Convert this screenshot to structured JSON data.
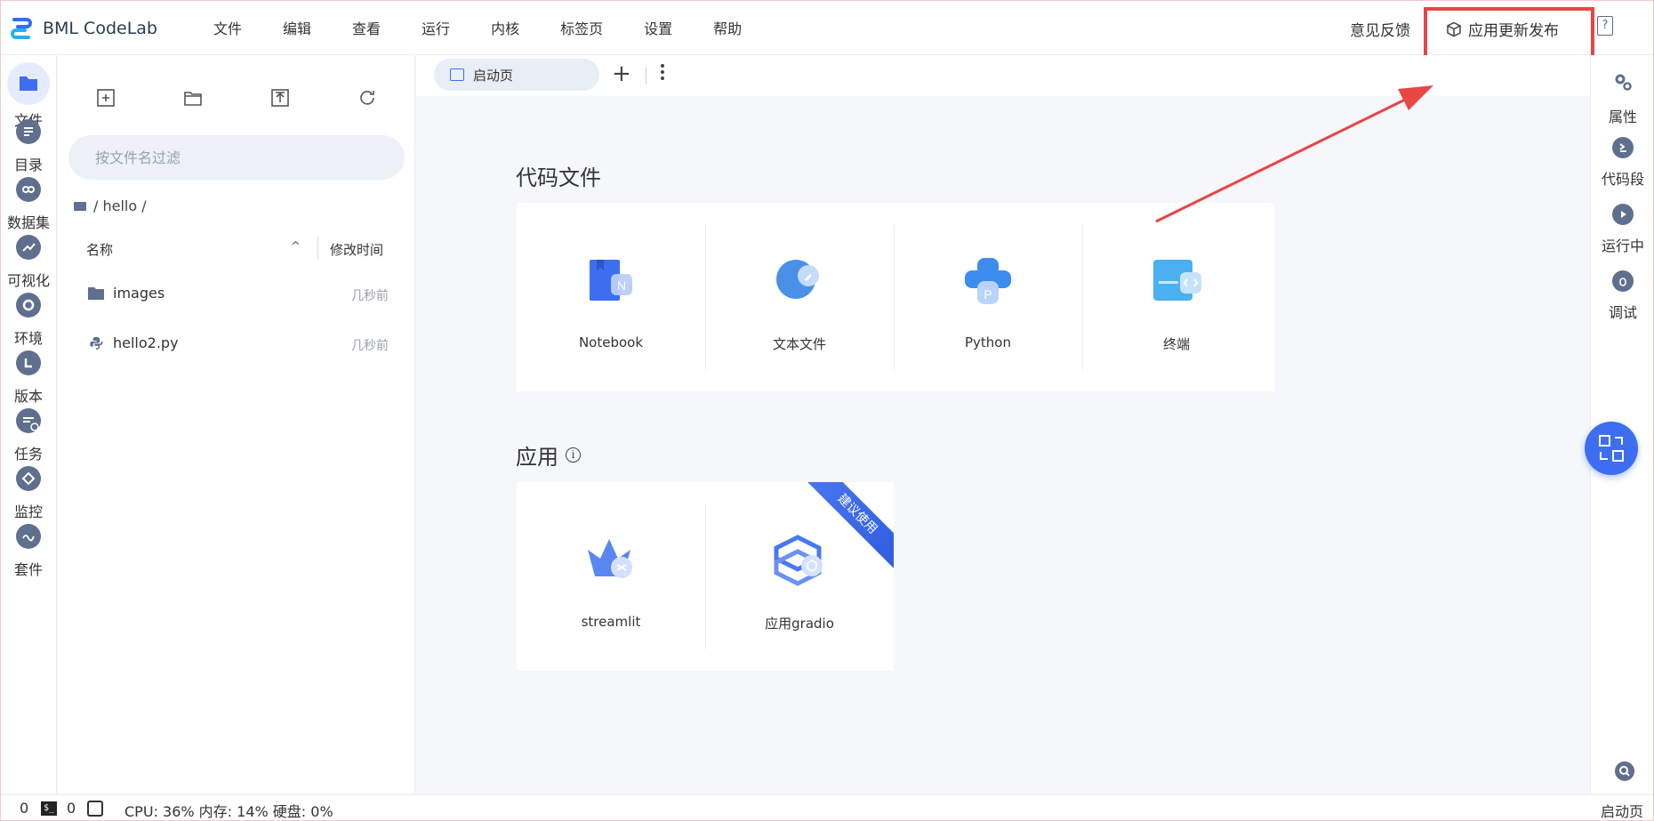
{
  "header": {
    "app_title": "BML CodeLab",
    "menu": [
      "文件",
      "编辑",
      "查看",
      "运行",
      "内核",
      "标签页",
      "设置",
      "帮助"
    ],
    "feedback_label": "意见反馈",
    "release_label": "应用更新发布",
    "help_label": "?"
  },
  "left_sidebar": {
    "items": [
      {
        "label": "文件",
        "icon": "folder-icon"
      },
      {
        "label": "目录",
        "icon": "list-icon"
      },
      {
        "label": "数据集",
        "icon": "dataset-icon"
      },
      {
        "label": "可视化",
        "icon": "chart-icon"
      },
      {
        "label": "环境",
        "icon": "environment-icon"
      },
      {
        "label": "版本",
        "icon": "version-icon"
      },
      {
        "label": "任务",
        "icon": "task-icon"
      },
      {
        "label": "监控",
        "icon": "monitor-icon"
      },
      {
        "label": "套件",
        "icon": "suite-icon"
      }
    ]
  },
  "file_panel": {
    "filter_placeholder": "按文件名过滤",
    "breadcrumb": "/ hello /",
    "col_name": "名称",
    "col_modified": "修改时间",
    "files": [
      {
        "name": "images",
        "time": "几秒前",
        "type": "folder"
      },
      {
        "name": "hello2.py",
        "time": "几秒前",
        "type": "python"
      }
    ]
  },
  "tabs": {
    "active_label": "启动页"
  },
  "launcher": {
    "code_section_title": "代码文件",
    "code_items": [
      {
        "label": "Notebook",
        "icon": "notebook-icon",
        "color": "#3d6ef0"
      },
      {
        "label": "文本文件",
        "icon": "text-file-icon",
        "color": "#4a90e8"
      },
      {
        "label": "Python",
        "icon": "python-icon",
        "color": "#3d8cf0"
      },
      {
        "label": "终端",
        "icon": "terminal-icon",
        "color": "#4ab0f0"
      }
    ],
    "app_section_title": "应用",
    "app_items": [
      {
        "label": "streamlit",
        "icon": "streamlit-icon"
      },
      {
        "label": "应用gradio",
        "icon": "gradio-icon"
      }
    ],
    "ribbon_label": "建议使用"
  },
  "right_sidebar": {
    "items": [
      {
        "label": "属性",
        "icon": "gear-icon"
      },
      {
        "label": "代码段",
        "icon": "code-snippet-icon"
      },
      {
        "label": "运行中",
        "icon": "play-icon"
      },
      {
        "label": "调试",
        "icon": "bug-icon"
      }
    ]
  },
  "status_bar": {
    "count_a": "0",
    "count_b": "0",
    "resources": "CPU:  36% 内存:  14% 硬盘:  0%",
    "right_label": "启动页"
  },
  "colors": {
    "accent": "#3d6ef0",
    "annotation": "#e84545"
  }
}
